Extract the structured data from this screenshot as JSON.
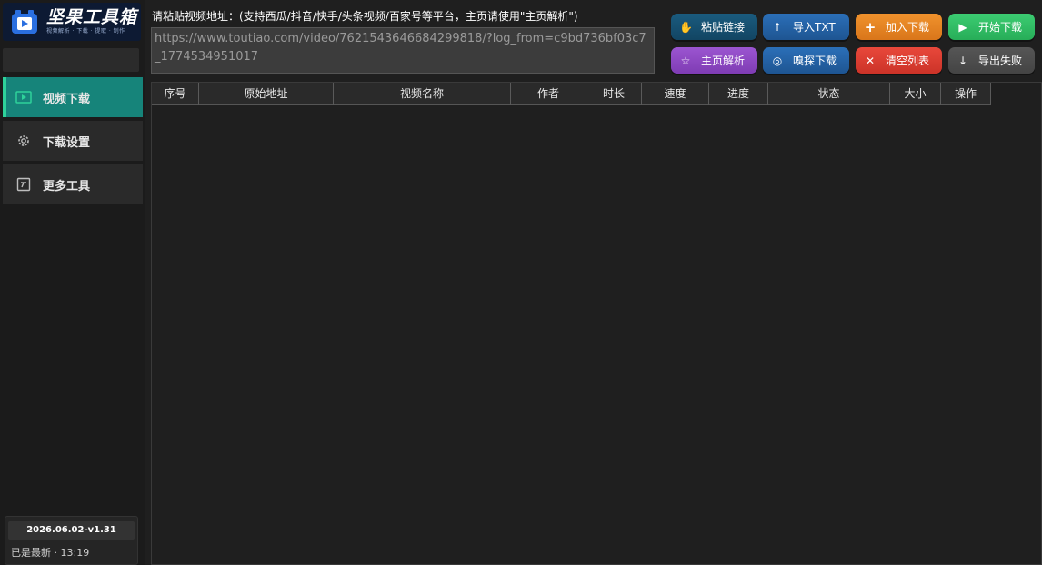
{
  "app": {
    "logo_title": "坚果工具箱",
    "logo_subtitle": "视频解析 · 下载 · 提取 · 制作"
  },
  "sidebar": {
    "items": [
      {
        "label": "视频下载",
        "icon": "video-play-icon",
        "active": true
      },
      {
        "label": "下载设置",
        "icon": "gear-icon",
        "active": false
      },
      {
        "label": "更多工具",
        "icon": "edit-box-icon",
        "active": false
      }
    ],
    "version": "2026.06.02-v1.31",
    "status": "已是最新 · 13:19"
  },
  "main": {
    "prompt_label": "请粘贴视频地址：(支持西瓜/抖音/快手/头条视频/百家号等平台，主页请使用\"主页解析\")",
    "url_value": "https://www.toutiao.com/video/7621543646684299818/?log_from=c9bd736bf03c7_1774534951017"
  },
  "buttons": {
    "paste": {
      "label": "粘贴链接",
      "icon": "hand-icon"
    },
    "import_txt": {
      "label": "导入TXT",
      "icon": "arrow-up-icon"
    },
    "add_download": {
      "label": "加入下载",
      "icon": "plus-icon"
    },
    "start_download": {
      "label": "开始下载",
      "icon": "play-icon"
    },
    "homepage_parse": {
      "label": "主页解析",
      "icon": "star-icon"
    },
    "sniff_download": {
      "label": "嗅探下载",
      "icon": "target-icon"
    },
    "clear_list": {
      "label": "清空列表",
      "icon": "close-icon"
    },
    "export_failed": {
      "label": "导出失败",
      "icon": "arrow-down-icon"
    }
  },
  "table": {
    "columns": [
      "序号",
      "原始地址",
      "视频名称",
      "作者",
      "时长",
      "速度",
      "进度",
      "状态",
      "大小",
      "操作"
    ],
    "rows": []
  },
  "colors": {
    "accent_teal": "#16847a",
    "active_bar": "#2ed29a",
    "blue": "#2b6fb8",
    "orange": "#f0922d",
    "green": "#3ccc72",
    "purple": "#9b55d1",
    "red": "#e8483b"
  }
}
